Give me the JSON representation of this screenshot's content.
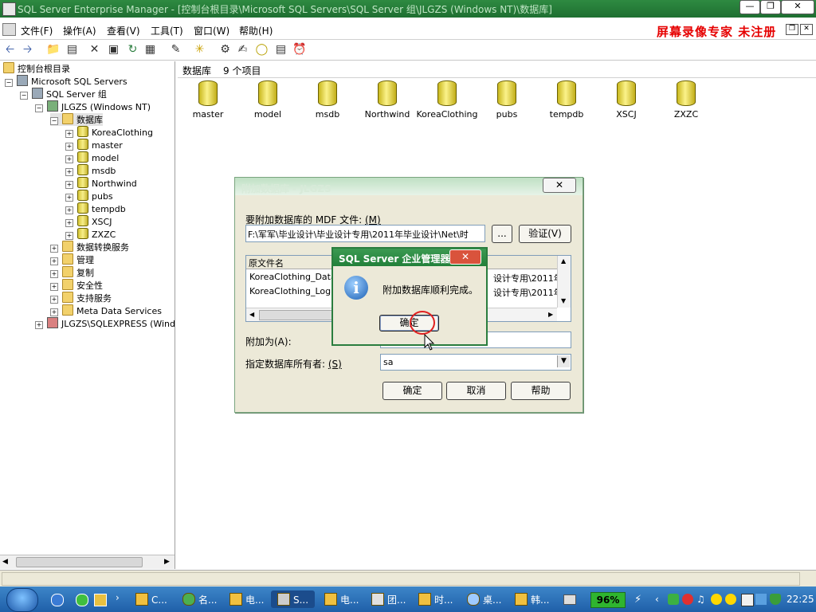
{
  "window": {
    "title": "SQL Server Enterprise Manager - [控制台根目录\\Microsoft SQL Servers\\SQL Server 组\\JLGZS (Windows NT)\\数据库]"
  },
  "menubar": {
    "items": [
      "文件(F)",
      "操作(A)",
      "查看(V)",
      "工具(T)",
      "窗口(W)",
      "帮助(H)"
    ],
    "watermark": "屏幕录像专家  未注册"
  },
  "tree": {
    "root": "控制台根目录",
    "servers": "Microsoft SQL Servers",
    "group": "SQL Server 组",
    "instance": "JLGZS (Windows NT)",
    "databases_folder": "数据库",
    "databases": [
      "KoreaClothing",
      "master",
      "model",
      "msdb",
      "Northwind",
      "pubs",
      "tempdb",
      "XSCJ",
      "ZXZC"
    ],
    "folders": [
      "数据转换服务",
      "管理",
      "复制",
      "安全性",
      "支持服务",
      "Meta Data Services"
    ],
    "instance2": "JLGZS\\SQLEXPRESS (Windows NT)"
  },
  "right_pane": {
    "header_label": "数据库",
    "item_count": "9 个项目",
    "databases": [
      "master",
      "model",
      "msdb",
      "Northwind",
      "KoreaClothing",
      "pubs",
      "tempdb",
      "XSCJ",
      "ZXZC"
    ]
  },
  "attach_dialog": {
    "title": "附加数据库 - JLGZS",
    "mdf_label": "要附加数据库的 MDF 文件:",
    "mdf_shortcut": "(M)",
    "mdf_path": "F:\\军军\\毕业设计\\毕业设计专用\\2011年毕业设计\\Net\\时",
    "browse_label": "...",
    "verify_label": "验证(V)",
    "table_header": "原文件名",
    "files": [
      "KoreaClothing_Data.M",
      "KoreaClothing_Log.LD"
    ],
    "file_paths": [
      "设计专用\\2011年!",
      "设计专用\\2011年!"
    ],
    "attach_as_label": "附加为(A):",
    "owner_label": "指定数据库所有者:",
    "owner_shortcut": "(S)",
    "owner_value": "sa",
    "ok_label": "确定",
    "cancel_label": "取消",
    "help_label": "帮助"
  },
  "message_box": {
    "title": "SQL Server 企业管理器",
    "message": "附加数据库顺利完成。",
    "ok_label": "确定"
  },
  "taskbar": {
    "tasks": [
      "C...",
      "名...",
      "电...",
      "S...",
      "电...",
      "团...",
      "时...",
      "桌...",
      "韩..."
    ],
    "percent": "96%",
    "clock": "22:25"
  }
}
